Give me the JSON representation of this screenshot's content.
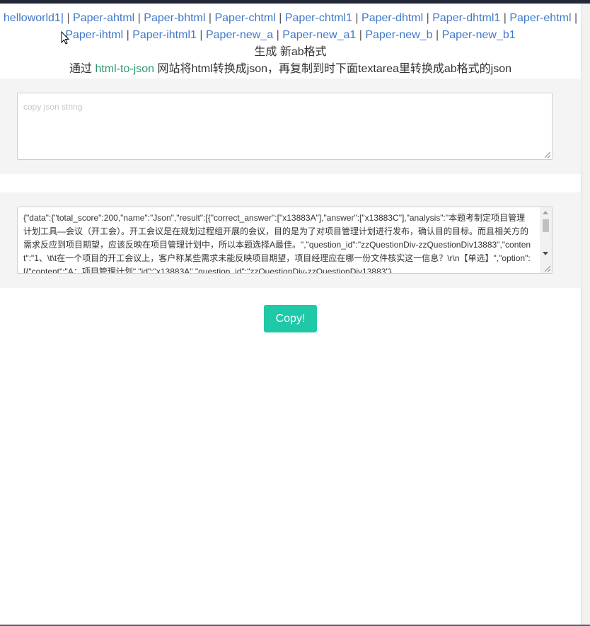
{
  "nav": {
    "links": [
      "helloworld1|",
      "Paper-ahtml",
      "Paper-bhtml",
      "Paper-chtml",
      "Paper-chtml1",
      "Paper-dhtml",
      "Paper-dhtml1",
      "Paper-ehtml",
      "Paper-ihtml",
      "Paper-ihtml1",
      "Paper-new_a",
      "Paper-new_a1",
      "Paper-new_b",
      "Paper-new_b1"
    ],
    "separator": "|"
  },
  "heading": {
    "generate_text": "生成 新ab格式",
    "instruction_prefix": "通过",
    "tool_link": "html-to-json",
    "instruction_suffix": "网站将html转换成json，再复制到时下面textarea里转换成ab格式的json"
  },
  "input_area": {
    "placeholder": "copy json string",
    "value": ""
  },
  "output_area": {
    "value": "{\"data\":{\"total_score\":200,\"name\":\"Json\",\"result\":[{\"correct_answer\":[\"x13883A\"],\"answer\":[\"x13883C\"],\"analysis\":\"本题考制定项目管理计划工具—会议（开工会）。开工会议是在规划过程组开展的会议，目的是为了对项目管理计划进行发布，确认目的目标。而且相关方的需求反应到项目期望，应该反映在项目管理计划中，所以本题选择A最佳。\",\"question_id\":\"zzQuestionDiv-zzQuestionDiv13883\",\"content\":\"1、\\t\\t在一个项目的开工会议上，客户称某些需求未能反映项目期望，项目经理应在哪一份文件核实这一信息？\\r\\n【单选】\",\"option\":[{\"content\":\"A：项目管理计划\",\"id\":\"x13883A\",\"question_id\":\"zzQuestionDiv-zzQuestionDiv13883\"},"
  },
  "copy_button": {
    "label": "Copy!"
  },
  "colors": {
    "link": "#3f78c8",
    "tool_link": "#2d9b6e",
    "button": "#1fc8a7",
    "panel": "#f4f4f4",
    "topbar": "#232838"
  }
}
